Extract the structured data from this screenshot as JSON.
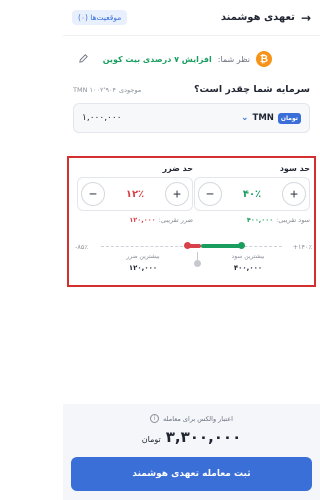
{
  "header": {
    "title": "تعهدی هوشمند",
    "positions_badge": "موقعیت‌ها (۰)"
  },
  "opinion": {
    "label": "نظر شما:",
    "value": "افزایش ۷ درصدی بیت کوین",
    "coin_symbol": "₿"
  },
  "capital": {
    "question": "سرمایه شما چقدر است؟",
    "balance_label": "موجودی",
    "balance_value": "TMN ۱۰۰۲٬۹۰۴"
  },
  "amount_input": {
    "currency": "TMN",
    "currency_badge": "تومان",
    "value": "۱,۰۰۰,۰۰۰"
  },
  "take_profit": {
    "title": "حد سود",
    "value": "۴۰٪",
    "approx_label": "سود تقریبی:",
    "approx_value": "۴۰۰,۰۰۰",
    "max_label": "بیشترین سود",
    "max_value": "۴۰۰,۰۰۰"
  },
  "stop_loss": {
    "title": "حد ضرر",
    "value": "۱۲٪",
    "approx_label": "ضرر تقریبی:",
    "approx_value": "۱۲۰,۰۰۰",
    "max_label": "بیشترین ضرر",
    "max_value": "۱۲۰,۰۰۰"
  },
  "slider": {
    "max_pct": "+۱۴۰٪",
    "min_pct": "-۸۵٪"
  },
  "footer": {
    "credit_label": "اعتبار والکس برای معامله",
    "total_value": "۳,۳۰۰,۰۰۰",
    "total_unit": "تومان",
    "submit_label": "ثبت معامله تعهدی هوشمند"
  },
  "colors": {
    "accent": "#3a6fd8",
    "profit": "#1a9e60",
    "loss": "#d8404a",
    "highlight_border": "#d32f2f"
  }
}
